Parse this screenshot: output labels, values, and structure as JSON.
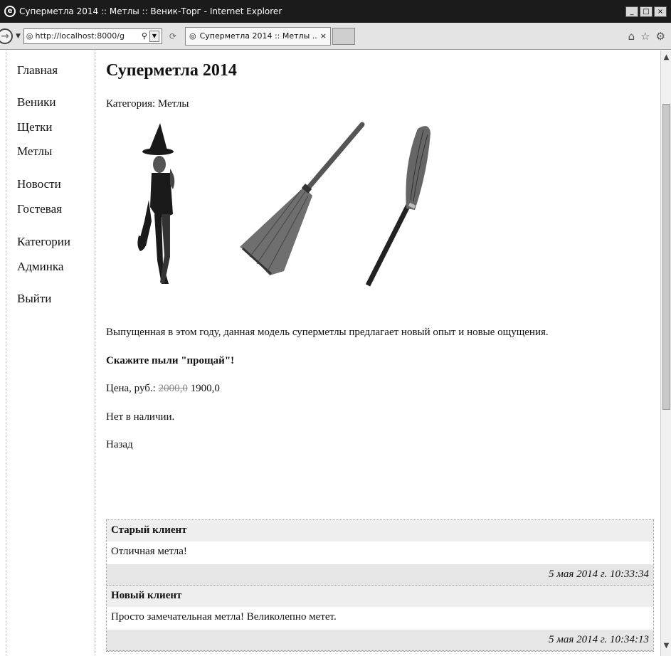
{
  "window": {
    "title": "Суперметла 2014 :: Метлы :: Веник-Торг - Internet Explorer",
    "minimize": "_",
    "maximize": "□",
    "close": "×"
  },
  "toolbar": {
    "address_url": "http://localhost:8000/g",
    "tab_title": "Суперметла 2014 :: Метлы ...",
    "tab_close": "×"
  },
  "sidebar": {
    "items": [
      {
        "label": "Главная"
      },
      {
        "label": "Веники"
      },
      {
        "label": "Щетки"
      },
      {
        "label": "Метлы"
      },
      {
        "label": "Новости"
      },
      {
        "label": "Гостевая"
      },
      {
        "label": "Категории"
      },
      {
        "label": "Админка"
      },
      {
        "label": "Выйти"
      }
    ]
  },
  "product": {
    "title": "Суперметла 2014",
    "category": "Категория: Метлы",
    "description": "Выпущенная в этом году, данная модель суперметлы предлагает новый опыт и новые ощущения.",
    "slogan": "Скажите пыли \"прощай\"!",
    "price_label": "Цена, руб.:",
    "old_price": "2000,0",
    "new_price": "1900,0",
    "availability": "Нет в наличии.",
    "back_link": "Назад"
  },
  "comments": [
    {
      "author": "Старый клиент",
      "text": "Отличная метла!",
      "date": "5 мая 2014 г. 10:33:34"
    },
    {
      "author": "Новый клиент",
      "text": "Просто замечательная метла! Великолепно метет.",
      "date": "5 мая 2014 г. 10:34:13"
    }
  ]
}
